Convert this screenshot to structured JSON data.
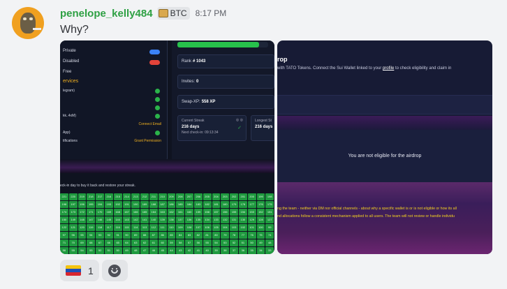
{
  "message": {
    "username": "penelope_kelly484",
    "tag": "BTC",
    "time": "8:17 PM",
    "text": "Why?"
  },
  "image1": {
    "settings": [
      {
        "label": "Private",
        "type": "toggle",
        "color": "#3b82f6"
      },
      {
        "label": "Disabled",
        "type": "toggle",
        "color": "#e3433a"
      },
      {
        "label": "Free",
        "type": "none"
      }
    ],
    "services_heading": "ervices",
    "services": [
      {
        "label": "legram)",
        "status": "check"
      },
      {
        "label": "",
        "status": "check"
      },
      {
        "label": "",
        "status": "check"
      },
      {
        "label": "kk..4xM)",
        "status": "check"
      },
      {
        "label": "",
        "status": "Connect Email"
      },
      {
        "label": "App)",
        "status": "check"
      },
      {
        "label": "tifications",
        "status": "Grant Permission"
      }
    ],
    "progress_pct": 90,
    "rank_label": "Rank",
    "rank_value": "# 1043",
    "invites_label": "Invites:",
    "invites_value": "0",
    "swap_label": "Swap-XP:",
    "swap_value": "558 XP",
    "current_streak_label": "Current Streak",
    "current_streak_value": "216 days",
    "next_checkin": "Next check-in: 09:13:34",
    "longest_streak_label": "Longest St",
    "longest_streak_value": "216 days",
    "grid_caption": "eck-in day to buy it back and restore your streak.",
    "grid_rows": [
      [
        "221",
        "220",
        "219",
        "218",
        "217",
        "216",
        "215",
        "214",
        "213",
        "212",
        "211",
        "210",
        "209",
        "208",
        "207",
        "206",
        "205",
        "204",
        "203",
        "202",
        "201",
        "200",
        "199",
        "198"
      ],
      [
        "198",
        "197",
        "196",
        "195",
        "194",
        "193",
        "192",
        "191",
        "190",
        "189",
        "188",
        "187",
        "186",
        "185",
        "184",
        "183",
        "182",
        "181",
        "180",
        "179",
        "178",
        "177",
        "176",
        "175"
      ],
      [
        "174",
        "173",
        "172",
        "171",
        "170",
        "169",
        "168",
        "167",
        "166",
        "165",
        "164",
        "163",
        "162",
        "161",
        "160",
        "159",
        "158",
        "157",
        "156",
        "155",
        "154",
        "153",
        "152",
        "151"
      ],
      [
        "150",
        "149",
        "148",
        "147",
        "146",
        "145",
        "144",
        "143",
        "142",
        "141",
        "140",
        "139",
        "138",
        "137",
        "136",
        "135",
        "134",
        "133",
        "132",
        "131",
        "130",
        "129",
        "128",
        "127"
      ],
      [
        "122",
        "121",
        "120",
        "119",
        "118",
        "117",
        "116",
        "115",
        "114",
        "113",
        "112",
        "111",
        "110",
        "109",
        "108",
        "107",
        "106",
        "105",
        "104",
        "103",
        "102",
        "101",
        "100",
        "99"
      ],
      [
        "97",
        "96",
        "95",
        "94",
        "93",
        "92",
        "91",
        "90",
        "89",
        "88",
        "87",
        "86",
        "85",
        "84",
        "83",
        "82",
        "81",
        "80",
        "79",
        "78",
        "77",
        "76",
        "75",
        "74"
      ],
      [
        "71",
        "70",
        "69",
        "68",
        "67",
        "66",
        "65",
        "64",
        "63",
        "62",
        "61",
        "60",
        "59",
        "58",
        "57",
        "56",
        "55",
        "54",
        "53",
        "52",
        "51",
        "50",
        "49",
        "48"
      ],
      [
        "56",
        "55",
        "54",
        "53",
        "52",
        "51",
        "50",
        "49",
        "48",
        "47",
        "46",
        "45",
        "44",
        "43",
        "42",
        "41",
        "40",
        "39",
        "38",
        "37",
        "36",
        "35",
        "34",
        "33"
      ],
      [
        "22",
        "21",
        "20",
        "19",
        "18",
        "17",
        "16",
        "15",
        "14",
        "13",
        "12",
        "11",
        "10",
        "9",
        "8",
        "7",
        "6",
        "5",
        "4",
        "3",
        "2",
        "1"
      ]
    ],
    "red_cells": [
      [
        8,
        13
      ],
      [
        8,
        14
      ],
      [
        8,
        18
      ],
      [
        8,
        19
      ],
      [
        8,
        20
      ]
    ]
  },
  "image2": {
    "title": "rop",
    "intro_prefix": "with TATO Tokens. Connect the Sui Wallet linked to your ",
    "intro_link": "profile",
    "intro_suffix": " to check eligibility and claim in",
    "note": "You are not eligible for the airdrop",
    "disclaimer1": "ng the team - neither via DM nor official channels - about why a specific wallet is or is not eligible or how its all",
    "disclaimer2": "nd allocations follow a consistent mechanism applied to all users. The team will not review or handle individu"
  },
  "reactions": [
    {
      "emoji": "venezuela-flag",
      "count": "1"
    }
  ],
  "colors": {
    "username": "#2ea043",
    "check": "#2bb34a",
    "warning": "#f0b020",
    "cell_green": "#1f9a3f",
    "cell_red": "#e3433a"
  }
}
